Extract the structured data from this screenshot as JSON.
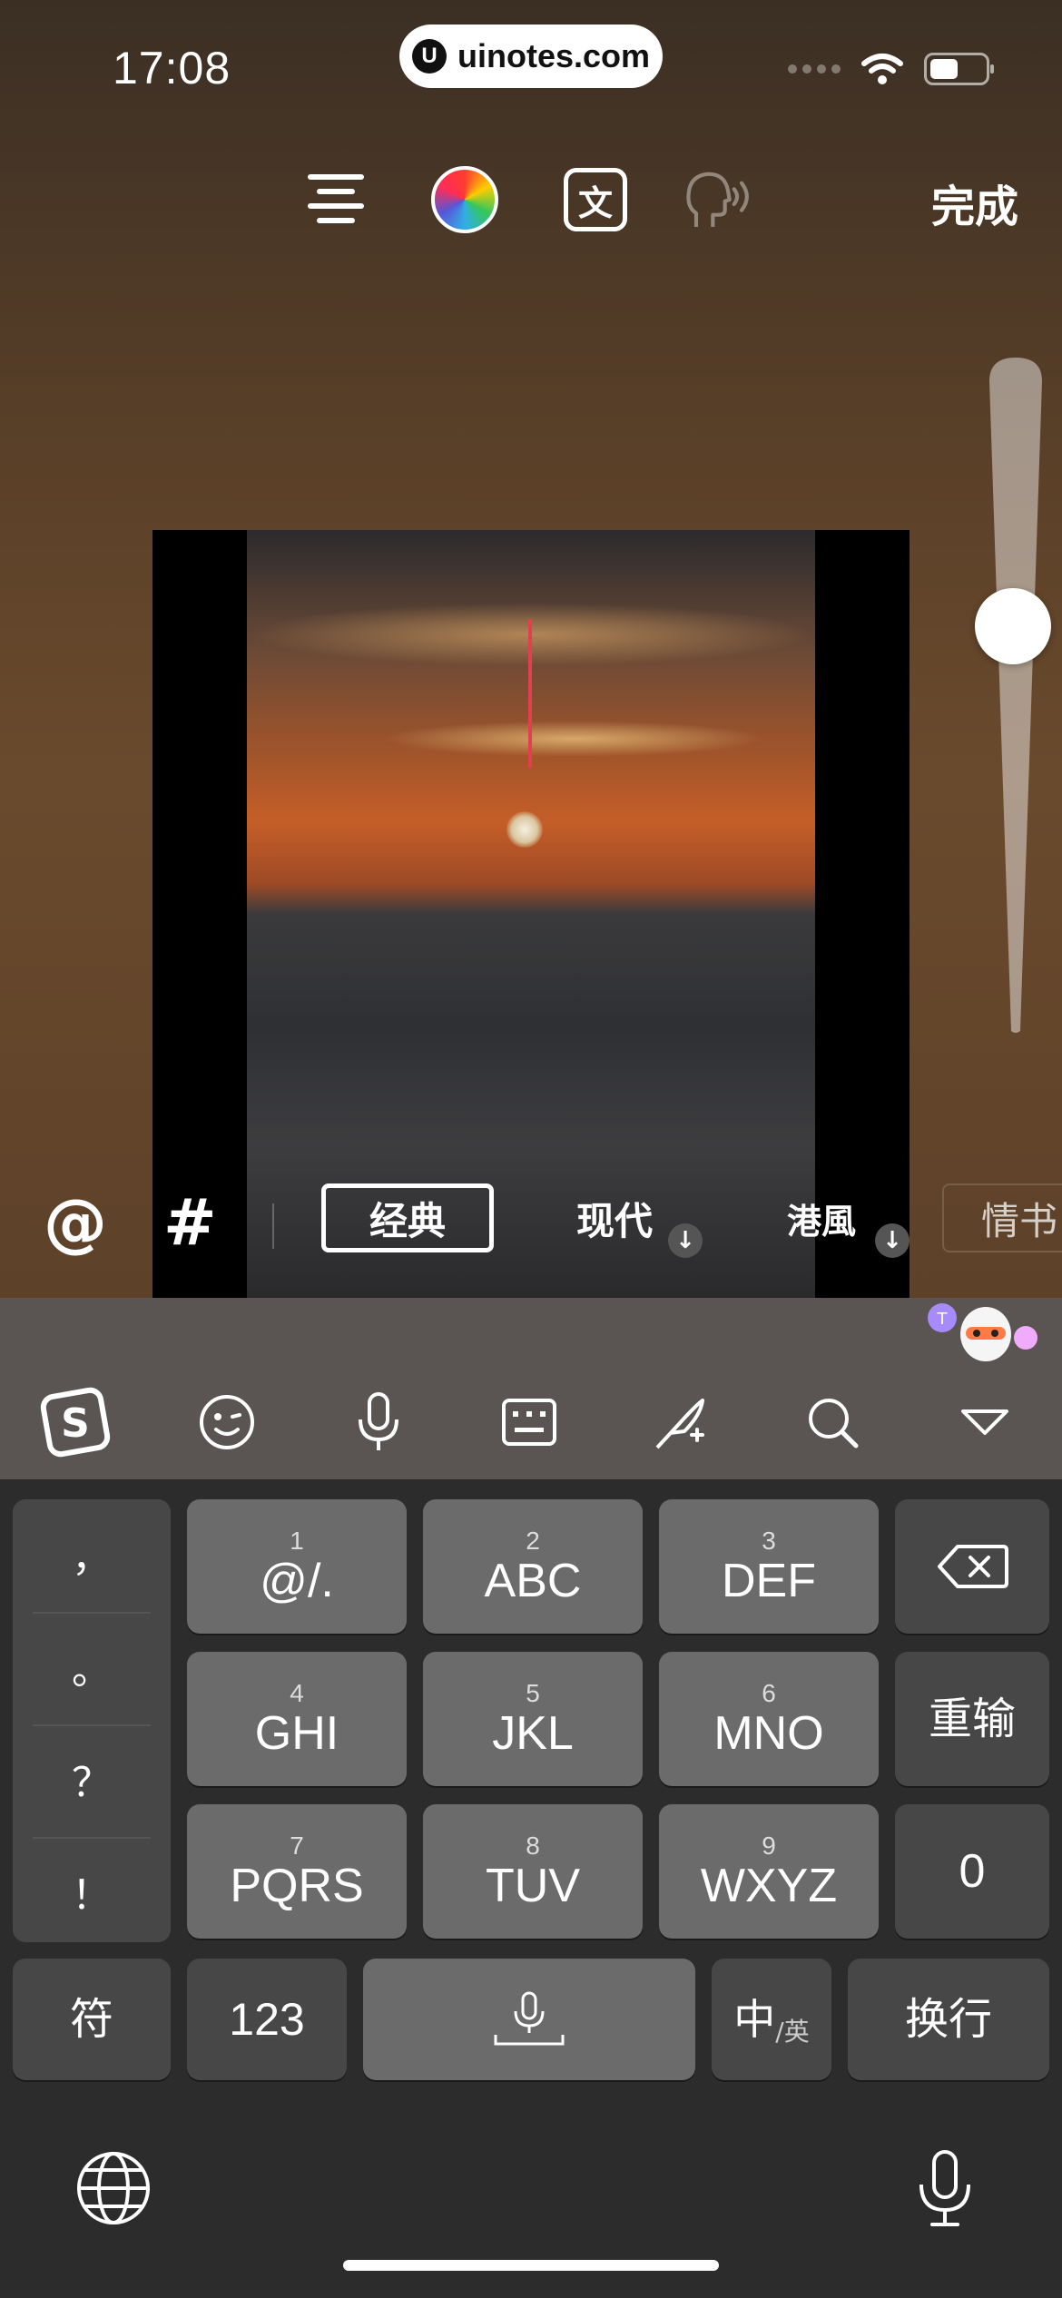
{
  "status": {
    "time": "17:08",
    "url": "uinotes.com"
  },
  "toolbar": {
    "icons": [
      "align-icon",
      "color-wheel-icon",
      "translate-icon",
      "text-to-speech-icon"
    ],
    "translate_glyph": "文",
    "done_label": "完成"
  },
  "chips": {
    "at": "@",
    "hash": "#",
    "fonts": [
      {
        "label": "经典",
        "selected": true
      },
      {
        "label": "现代",
        "download": true
      },
      {
        "label": "港風",
        "download": true
      },
      {
        "label": "情书"
      }
    ]
  },
  "keyboard_toolbar": {
    "icons": [
      "sogou-logo-icon",
      "emoji-icon",
      "microphone-icon",
      "keyboard-icon",
      "handwriting-icon",
      "search-icon",
      "collapse-icon"
    ]
  },
  "keyboard": {
    "punctuation": [
      "，",
      "。",
      "？",
      "！"
    ],
    "keys": [
      {
        "num": "1",
        "label": "@/."
      },
      {
        "num": "2",
        "label": "ABC"
      },
      {
        "num": "3",
        "label": "DEF"
      },
      {
        "num": "4",
        "label": "GHI"
      },
      {
        "num": "5",
        "label": "JKL"
      },
      {
        "num": "6",
        "label": "MNO"
      },
      {
        "num": "7",
        "label": "PQRS"
      },
      {
        "num": "8",
        "label": "TUV"
      },
      {
        "num": "9",
        "label": "WXYZ"
      }
    ],
    "delete_icon": "backspace-icon",
    "retype": "重输",
    "zero": "0",
    "symbols": "符",
    "numbers": "123",
    "lang_main": "中",
    "lang_sub": "/英",
    "newline": "换行"
  },
  "bottom": {
    "left_icon": "globe-icon",
    "right_icon": "dictation-icon"
  }
}
